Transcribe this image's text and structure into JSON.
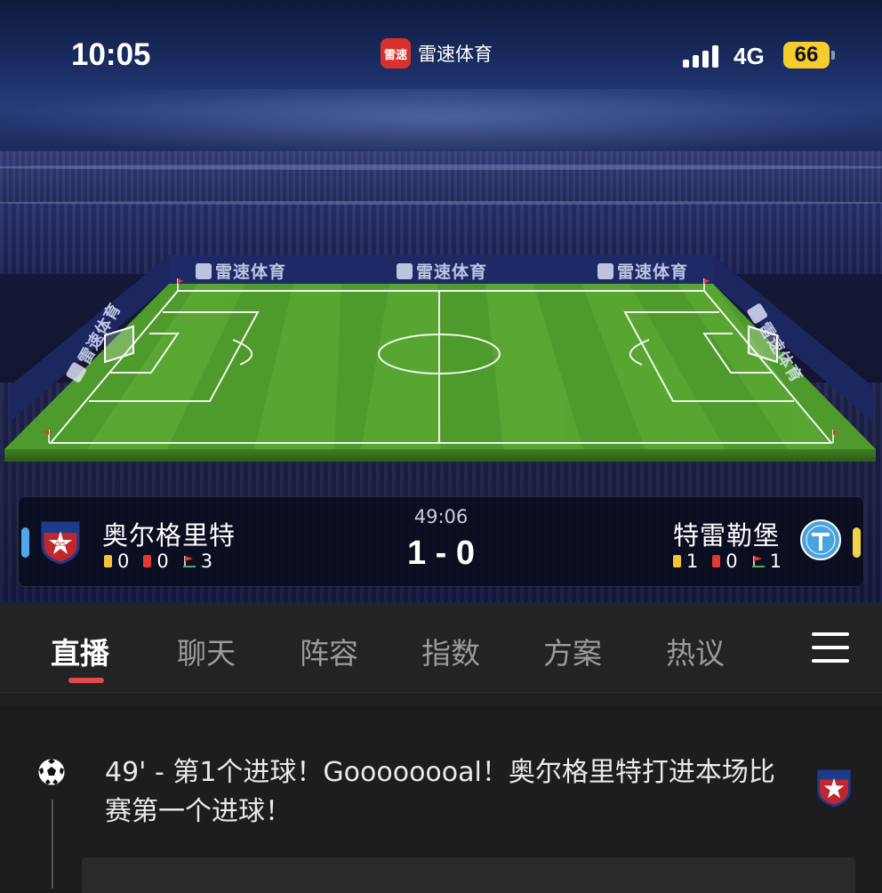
{
  "status_bar": {
    "time": "10:05",
    "app_icon_text": "雷速",
    "app_name": "雷速体育",
    "network": "4G",
    "battery": "66"
  },
  "pitch": {
    "board_logo_text": "雷速体育"
  },
  "match": {
    "clock": "49:06",
    "score": "1 - 0",
    "home": {
      "name": "奥尔格里特",
      "yellow_cards": "0",
      "red_cards": "0",
      "corners": "3",
      "color": "#4ea8ec"
    },
    "away": {
      "name": "特雷勒堡",
      "yellow_cards": "1",
      "red_cards": "0",
      "corners": "1",
      "color": "#f4d34a"
    }
  },
  "tabs": [
    {
      "label": "直播",
      "active": true
    },
    {
      "label": "聊天",
      "active": false
    },
    {
      "label": "阵容",
      "active": false
    },
    {
      "label": "指数",
      "active": false
    },
    {
      "label": "方案",
      "active": false
    },
    {
      "label": "热议",
      "active": false
    }
  ],
  "feed": {
    "events": [
      {
        "icon": "soccer-ball-icon",
        "text": "49' - 第1个进球！Goooooooal！奥尔格里特打进本场比赛第一个进球！"
      }
    ]
  },
  "colors": {
    "accent": "#e04a4a",
    "battery": "#f6cd2e",
    "pitch_green": "#4f9a2c"
  }
}
